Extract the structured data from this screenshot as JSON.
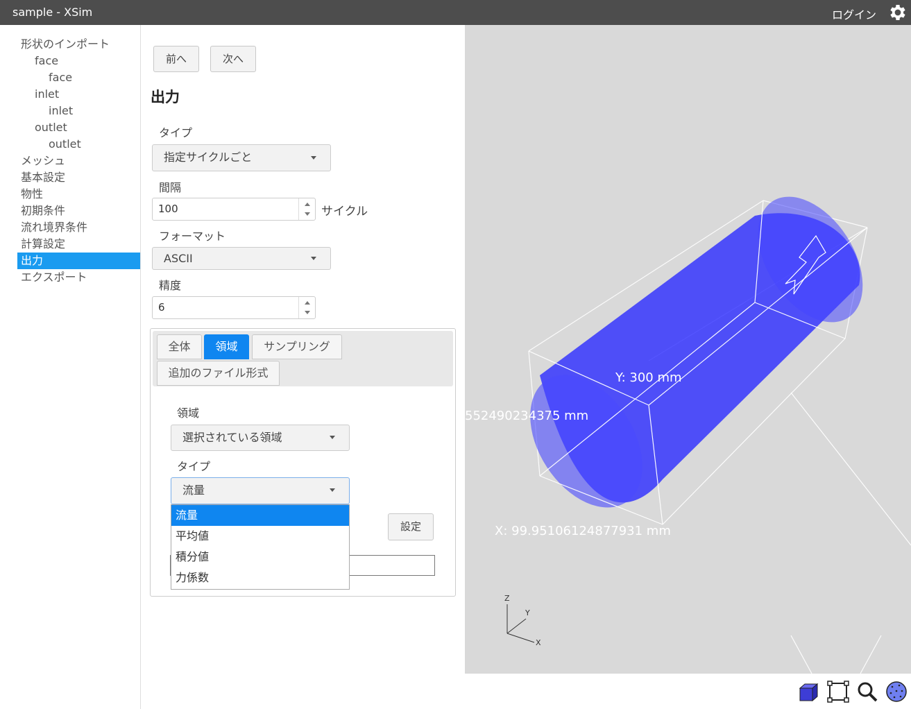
{
  "app": {
    "title": "sample - XSim",
    "login_label": "ログイン"
  },
  "sidebar": {
    "items": [
      {
        "label": "形状のインポート",
        "level": 0
      },
      {
        "label": "face",
        "level": 1
      },
      {
        "label": "face",
        "level": 2
      },
      {
        "label": "inlet",
        "level": 1
      },
      {
        "label": "inlet",
        "level": 2
      },
      {
        "label": "outlet",
        "level": 1
      },
      {
        "label": "outlet",
        "level": 2
      },
      {
        "label": "メッシュ",
        "level": 0
      },
      {
        "label": "基本設定",
        "level": 0
      },
      {
        "label": "物性",
        "level": 0
      },
      {
        "label": "初期条件",
        "level": 0
      },
      {
        "label": "流れ境界条件",
        "level": 0
      },
      {
        "label": "計算設定",
        "level": 0
      },
      {
        "label": "出力",
        "level": 0,
        "active": true
      },
      {
        "label": "エクスポート",
        "level": 0
      }
    ]
  },
  "panel": {
    "prev_label": "前へ",
    "next_label": "次へ",
    "heading": "出力",
    "type_label": "タイプ",
    "type_value": "指定サイクルごと",
    "interval_label": "間隔",
    "interval_value": "100",
    "interval_unit": "サイクル",
    "format_label": "フォーマット",
    "format_value": "ASCII",
    "precision_label": "精度",
    "precision_value": "6",
    "tabs": [
      {
        "label": "全体"
      },
      {
        "label": "領域",
        "active": true
      },
      {
        "label": "サンプリング"
      },
      {
        "label": "追加のファイル形式"
      }
    ],
    "region_label": "領域",
    "region_value": "選択されている領域",
    "region_type_label": "タイプ",
    "region_type_value": "流量",
    "dropdown_options": [
      "流量",
      "平均値",
      "積分値",
      "力係数"
    ],
    "selected_option": "流量",
    "set_button_label": "設定"
  },
  "viewport": {
    "label_y": "Y: 300 mm",
    "label_z_partial": "552490234375 mm",
    "label_x": "X: 99.95106124877931 mm",
    "axis_labels": [
      "Z",
      "Y",
      "X"
    ],
    "cylinder_color": "#3333ff"
  },
  "toolbar": {
    "icons": [
      "cube-view-icon",
      "fit-view-icon",
      "zoom-icon",
      "mesh-view-icon"
    ]
  }
}
